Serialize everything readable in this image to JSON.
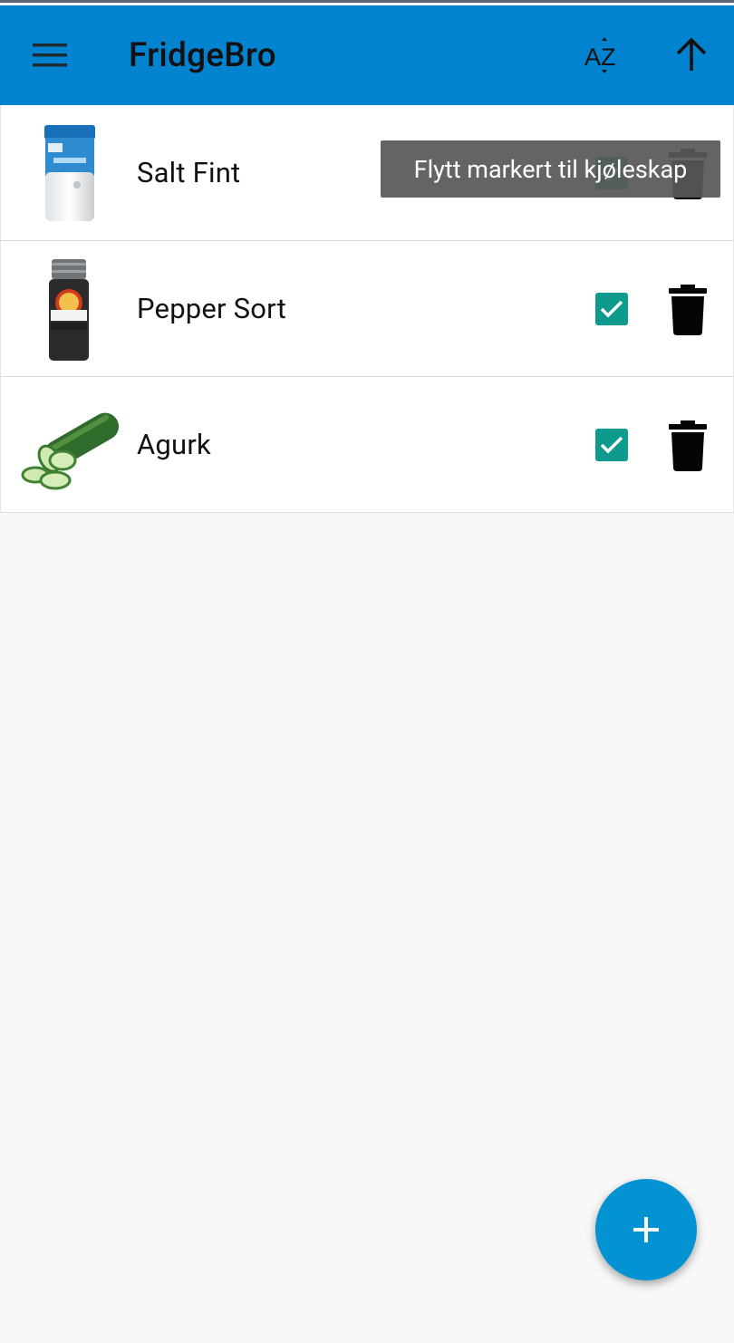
{
  "app": {
    "title": "FridgeBro"
  },
  "toolbar": {
    "menu_icon": "menu-icon",
    "sort_icon": "sort-az-icon",
    "sort_label": "AZ",
    "up_icon": "arrow-up-icon"
  },
  "items": [
    {
      "name": "Salt Fint",
      "checked": true,
      "image": "salt-shaker-image"
    },
    {
      "name": "Pepper Sort",
      "checked": true,
      "image": "pepper-grinder-image"
    },
    {
      "name": "Agurk",
      "checked": true,
      "image": "cucumber-image"
    }
  ],
  "toast": {
    "text": "Flytt markert til kjøleskap"
  },
  "fab": {
    "icon": "plus-icon"
  },
  "colors": {
    "appbar": "#0283d0",
    "checkbox": "#0e9a8c",
    "fab": "#0393d2",
    "toast": "#585858"
  }
}
